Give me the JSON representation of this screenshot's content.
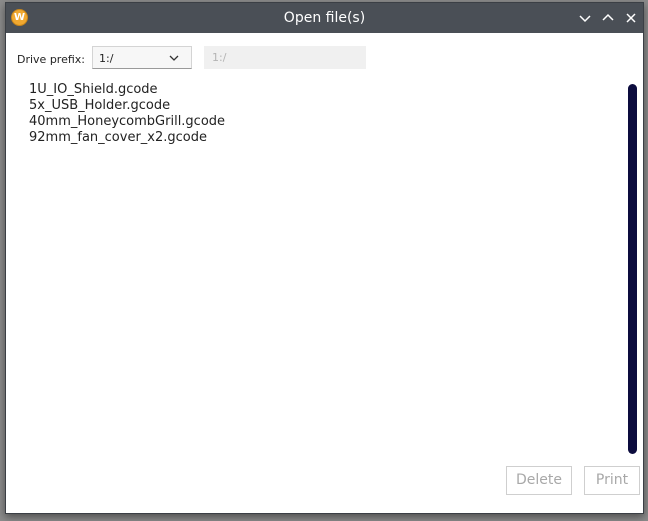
{
  "window": {
    "title": "Open file(s)",
    "app_icon_glyph": "W",
    "app_icon_color": "#f0a830",
    "titlebar_color": "#4a4f56"
  },
  "drive": {
    "label": "Drive prefix:",
    "selected": "1:/",
    "input_placeholder": "1:/"
  },
  "files": [
    "1U_IO_Shield.gcode",
    "5x_USB_Holder.gcode",
    "40mm_HoneycombGrill.gcode",
    "92mm_fan_cover_x2.gcode"
  ],
  "scrollbar_color": "#0c0c3e",
  "actions": {
    "delete_label": "Delete",
    "print_label": "Print"
  },
  "icons": [
    "app-logo-icon",
    "minimize-icon",
    "maximize-icon",
    "close-icon",
    "chevron-down-icon"
  ]
}
